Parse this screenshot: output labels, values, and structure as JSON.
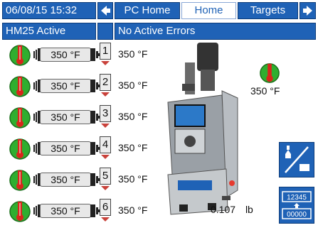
{
  "header": {
    "datetime": "06/08/15 15:32",
    "tabs": [
      {
        "label": "PC Home",
        "selected": false
      },
      {
        "label": "Home",
        "selected": true
      },
      {
        "label": "Targets",
        "selected": false
      }
    ],
    "status_mode": "HM25 Active",
    "status_errors": "No Active Errors"
  },
  "zones": [
    {
      "number": "1",
      "setpoint": "350 °F",
      "actual": "350 °F",
      "state": "on"
    },
    {
      "number": "2",
      "setpoint": "350 °F",
      "actual": "350 °F",
      "state": "on"
    },
    {
      "number": "3",
      "setpoint": "350 °F",
      "actual": "350 °F",
      "state": "on"
    },
    {
      "number": "4",
      "setpoint": "350 °F",
      "actual": "350 °F",
      "state": "on"
    },
    {
      "number": "5",
      "setpoint": "350 °F",
      "actual": "350 °F",
      "state": "on"
    },
    {
      "number": "6",
      "setpoint": "350 °F",
      "actual": "350 °F",
      "state": "on"
    }
  ],
  "tank": {
    "temperature": "350 °F"
  },
  "material": {
    "amount": "0.107",
    "unit": "lb"
  },
  "counter_icon": {
    "value": "12345",
    "reset": "00000"
  },
  "icons": {
    "back": "arrow-left-icon",
    "forward": "arrow-right-icon",
    "gauge": "temperature-gauge-icon",
    "pump": "pump-toggle-icon",
    "counter": "counter-reset-icon"
  },
  "colors": {
    "accent": "#1f62b6",
    "gauge_green": "#2fae2f",
    "gauge_red": "#d8261c"
  }
}
